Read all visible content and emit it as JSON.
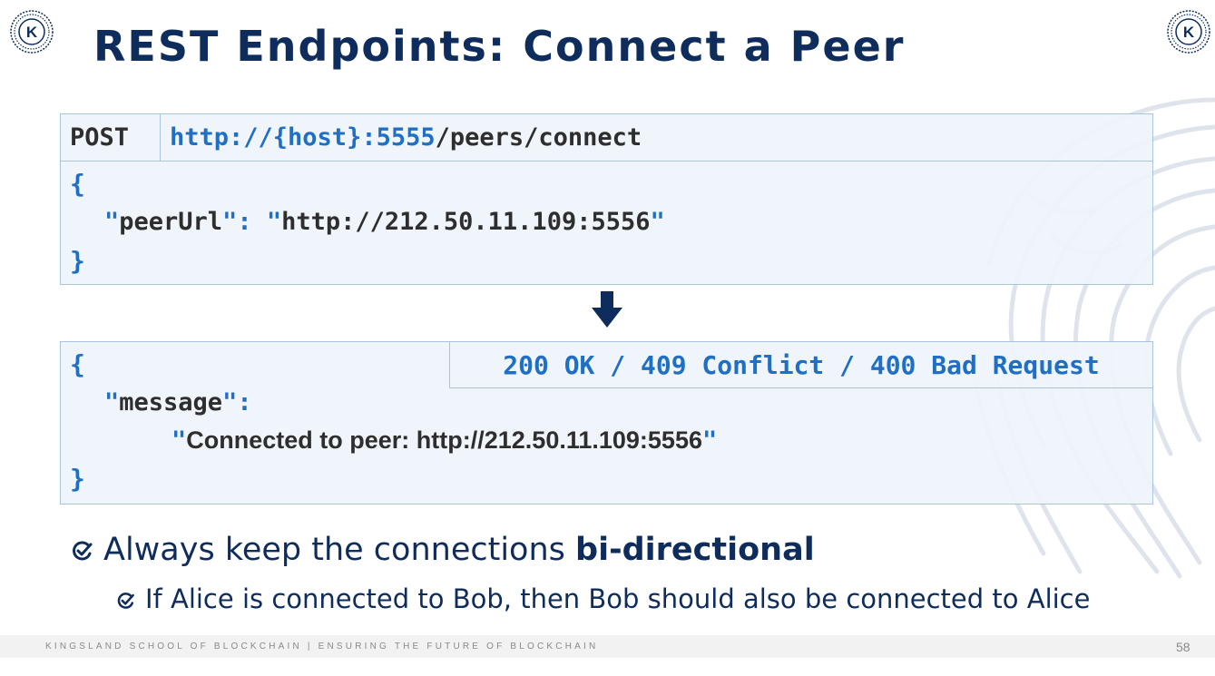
{
  "slide": {
    "title": "REST Endpoints: Connect a Peer",
    "page_number": "58"
  },
  "request": {
    "method": "POST",
    "url_base": "http://{host}:5555",
    "url_path": "/peers/connect",
    "body_open": "{",
    "body_key": "peerUrl",
    "body_value": "http://212.50.11.109:5556",
    "body_close": "}"
  },
  "response": {
    "status": "200 OK / 409 Conflict / 400 Bad Request",
    "body_open": "{",
    "body_key": "message",
    "body_value": "Connected to peer: http://212.50.11.109:5556",
    "body_close": "}"
  },
  "bullets": {
    "main_prefix": "Always keep the connections ",
    "main_bold": "bi-directional",
    "sub": "If Alice is connected to Bob, then Bob should also be connected to Alice"
  },
  "footer": {
    "text": "KINGSLAND SCHOOL OF BLOCKCHAIN | ENSURING THE FUTURE OF BLOCKCHAIN"
  },
  "logo": {
    "letter": "K"
  },
  "colors": {
    "title": "#0f2d5c",
    "accent_blue": "#1f6fc5",
    "box_fill": "#eff4fb",
    "box_border": "#a8c4e0",
    "arrow": "#0f2d5c"
  }
}
